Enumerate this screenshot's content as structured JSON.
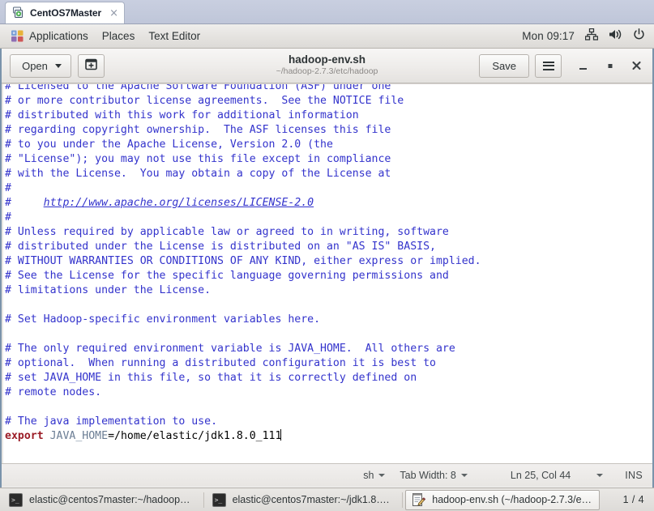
{
  "vm_tab": {
    "label": "CentOS7Master",
    "close_label": "×",
    "icon": "virtual-machine-icon"
  },
  "gnome_panel": {
    "applications": "Applications",
    "places": "Places",
    "active_app": "Text Editor",
    "clock": "Mon 09:17",
    "icons": [
      "network-icon",
      "volume-icon",
      "power-icon"
    ]
  },
  "headerbar": {
    "open_label": "Open",
    "new_tab_icon": "new-document-icon",
    "title": "hadoop-env.sh",
    "subtitle": "~/hadoop-2.7.3/etc/hadoop",
    "save_label": "Save",
    "menu_icon": "hamburger-menu-icon",
    "minimize_icon": "minimize-icon",
    "maximize_icon": "maximize-icon",
    "close_icon": "close-icon"
  },
  "editor": {
    "lines": [
      {
        "type": "comment",
        "text": "# Licensed to the Apache Software Foundation (ASF) under one"
      },
      {
        "type": "comment",
        "text": "# or more contributor license agreements.  See the NOTICE file"
      },
      {
        "type": "comment",
        "text": "# distributed with this work for additional information"
      },
      {
        "type": "comment",
        "text": "# regarding copyright ownership.  The ASF licenses this file"
      },
      {
        "type": "comment",
        "text": "# to you under the Apache License, Version 2.0 (the"
      },
      {
        "type": "comment",
        "text": "# \"License\"); you may not use this file except in compliance"
      },
      {
        "type": "comment",
        "text": "# with the License.  You may obtain a copy of the License at"
      },
      {
        "type": "comment",
        "text": "#"
      },
      {
        "type": "link",
        "prefix": "#     ",
        "text": "http://www.apache.org/licenses/LICENSE-2.0"
      },
      {
        "type": "comment",
        "text": "#"
      },
      {
        "type": "comment",
        "text": "# Unless required by applicable law or agreed to in writing, software"
      },
      {
        "type": "comment",
        "text": "# distributed under the License is distributed on an \"AS IS\" BASIS,"
      },
      {
        "type": "comment",
        "text": "# WITHOUT WARRANTIES OR CONDITIONS OF ANY KIND, either express or implied."
      },
      {
        "type": "comment",
        "text": "# See the License for the specific language governing permissions and"
      },
      {
        "type": "comment",
        "text": "# limitations under the License."
      },
      {
        "type": "blank",
        "text": ""
      },
      {
        "type": "comment",
        "text": "# Set Hadoop-specific environment variables here."
      },
      {
        "type": "blank",
        "text": ""
      },
      {
        "type": "comment",
        "text": "# The only required environment variable is JAVA_HOME.  All others are"
      },
      {
        "type": "comment",
        "text": "# optional.  When running a distributed configuration it is best to"
      },
      {
        "type": "comment",
        "text": "# set JAVA_HOME in this file, so that it is correctly defined on"
      },
      {
        "type": "comment",
        "text": "# remote nodes."
      },
      {
        "type": "blank",
        "text": ""
      },
      {
        "type": "comment",
        "text": "# The java implementation to use."
      },
      {
        "type": "export",
        "keyword": "export",
        "variable": "JAVA_HOME",
        "value": "=/home/elastic/jdk1.8.0_111"
      }
    ],
    "colors": {
      "comment": "#3333cc",
      "keyword": "#9b1c26",
      "variable": "#6b7d94",
      "plain": "#000000",
      "background": "#ffffff"
    }
  },
  "statusbar": {
    "language": "sh",
    "tab_width": "Tab Width: 8",
    "position": "Ln 25, Col 44",
    "insert_mode": "INS"
  },
  "taskbar": {
    "tasks": [
      {
        "icon": "terminal-icon",
        "label": "elastic@centos7master:~/hadoop…",
        "active": false
      },
      {
        "icon": "terminal-icon",
        "label": "elastic@centos7master:~/jdk1.8….",
        "active": false
      },
      {
        "icon": "text-editor-icon",
        "label": "hadoop-env.sh (~/hadoop-2.7.3/e…",
        "active": true
      }
    ],
    "workspace": "1 / 4"
  }
}
